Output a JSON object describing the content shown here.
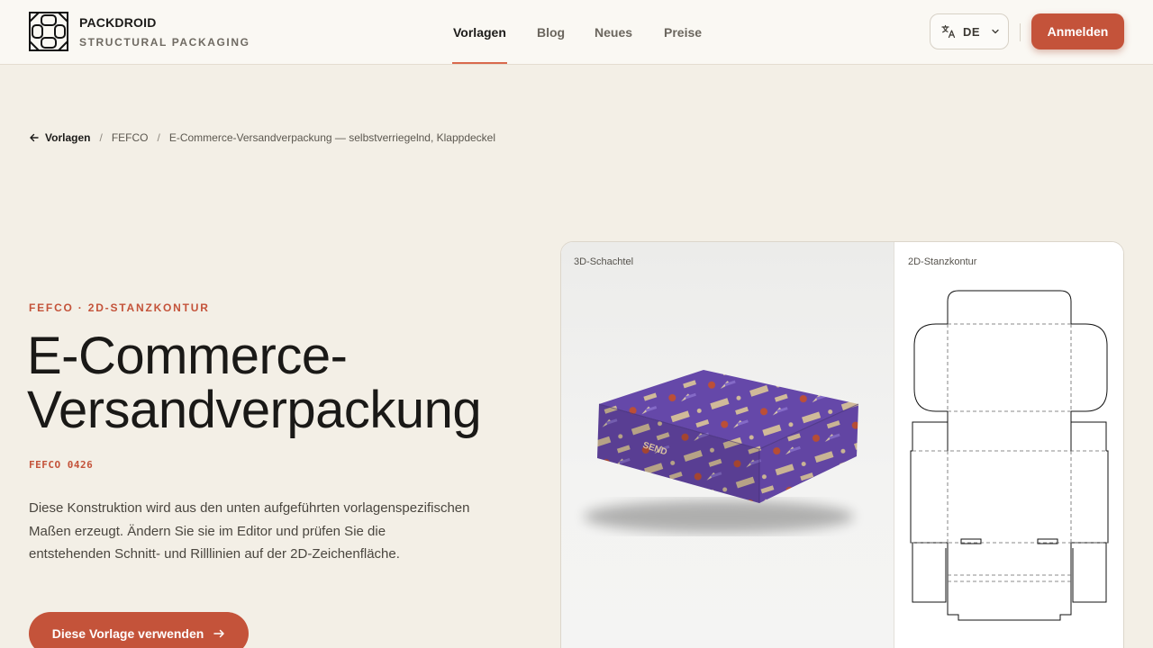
{
  "brand": {
    "name": "PACKDROID",
    "subtitle": "STRUCTURAL PACKAGING"
  },
  "nav": {
    "items": [
      {
        "label": "Vorlagen",
        "active": true
      },
      {
        "label": "Blog",
        "active": false
      },
      {
        "label": "Neues",
        "active": false
      },
      {
        "label": "Preise",
        "active": false
      }
    ]
  },
  "language": {
    "current": "DE",
    "icon": "translate-icon"
  },
  "header": {
    "login_label": "Anmelden"
  },
  "breadcrumb": {
    "back_label": "Vorlagen",
    "items": [
      "FEFCO",
      "E-Commerce-Versandverpackung — selbstverriegelnd, Klappdeckel"
    ]
  },
  "hero": {
    "eyebrow": "FEFCO · 2D-STANZKONTUR",
    "title_line1": "E-Commerce-",
    "title_line2": "Versandverpackung",
    "code": "FEFCO 0426",
    "description": "Diese Konstruktion wird aus den unten aufgeführten vorlagenspezifischen Maßen erzeugt. Ändern Sie sie im Editor und prüfen Sie die entstehenden Schnitt- und Rilllinien auf der 2D-Zeichenfläche.",
    "cta_label": "Diese Vorlage verwenden"
  },
  "preview": {
    "label_3d": "3D-Schachtel",
    "label_2d": "2D-Stanzkontur",
    "box_print_text": "SEND",
    "colors": {
      "box_purple": "#6a4bb0",
      "box_kraft": "#d9c2a0",
      "accent": "#c4533a"
    }
  }
}
